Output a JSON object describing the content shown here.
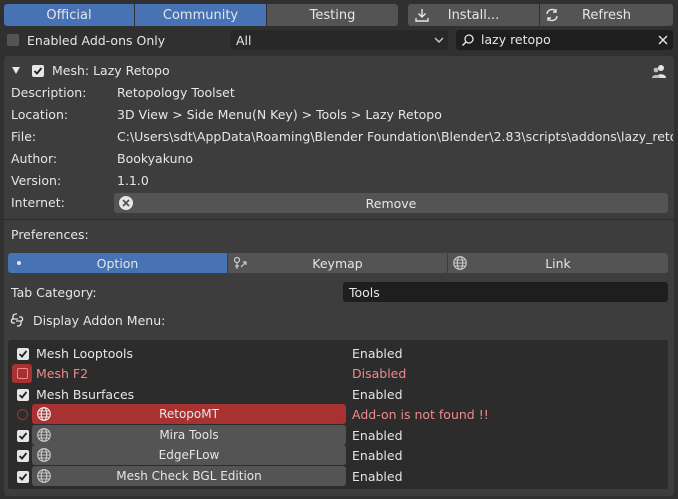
{
  "tabs": {
    "official": "Official",
    "community": "Community",
    "testing": "Testing",
    "install": "Install...",
    "refresh": "Refresh"
  },
  "filter": {
    "enabled_only": "Enabled Add-ons Only",
    "category": "All",
    "search_value": "lazy retopo"
  },
  "addon": {
    "name": "Mesh: Lazy Retopo",
    "fields": [
      {
        "label": "Description:",
        "value": "Retopology Toolset"
      },
      {
        "label": "Location:",
        "value": "3D View > Side Menu(N Key) > Tools > Lazy Retopo"
      },
      {
        "label": "File:",
        "value": "C:\\Users\\sdt\\AppData\\Roaming\\Blender Foundation\\Blender\\2.83\\scripts\\addons\\lazy_retopo\\__init__.p"
      },
      {
        "label": "Author:",
        "value": "Bookyakuno"
      },
      {
        "label": "Version:",
        "value": "1.1.0"
      },
      {
        "label": "Internet:",
        "value": ""
      }
    ],
    "remove_label": "Remove"
  },
  "prefs": {
    "title": "Preferences:",
    "tabs": [
      "Option",
      "Keymap",
      "Link"
    ],
    "tab_category_label": "Tab Category:",
    "tab_category_value": "Tools",
    "display_menu_label": "Display Addon Menu:"
  },
  "addon_list": [
    {
      "name": "Mesh Looptools",
      "status": "Enabled",
      "checked": true
    },
    {
      "name": "Mesh F2",
      "status": "Disabled",
      "checked": false
    },
    {
      "name": "Mesh Bsurfaces",
      "status": "Enabled",
      "checked": true
    },
    {
      "name": "RetopoMT",
      "status": "Add-on is not found !!",
      "checked": false
    },
    {
      "name": "Mira Tools",
      "status": "Enabled",
      "checked": true
    },
    {
      "name": "EdgeFLow",
      "status": "Enabled",
      "checked": true
    },
    {
      "name": "Mesh Check BGL Edition",
      "status": "Enabled",
      "checked": true
    }
  ],
  "colors": {
    "accent": "#4772b3",
    "error": "#a83232",
    "error_text": "#f08a8a",
    "panel": "#3d3d3d",
    "button": "#545454"
  }
}
